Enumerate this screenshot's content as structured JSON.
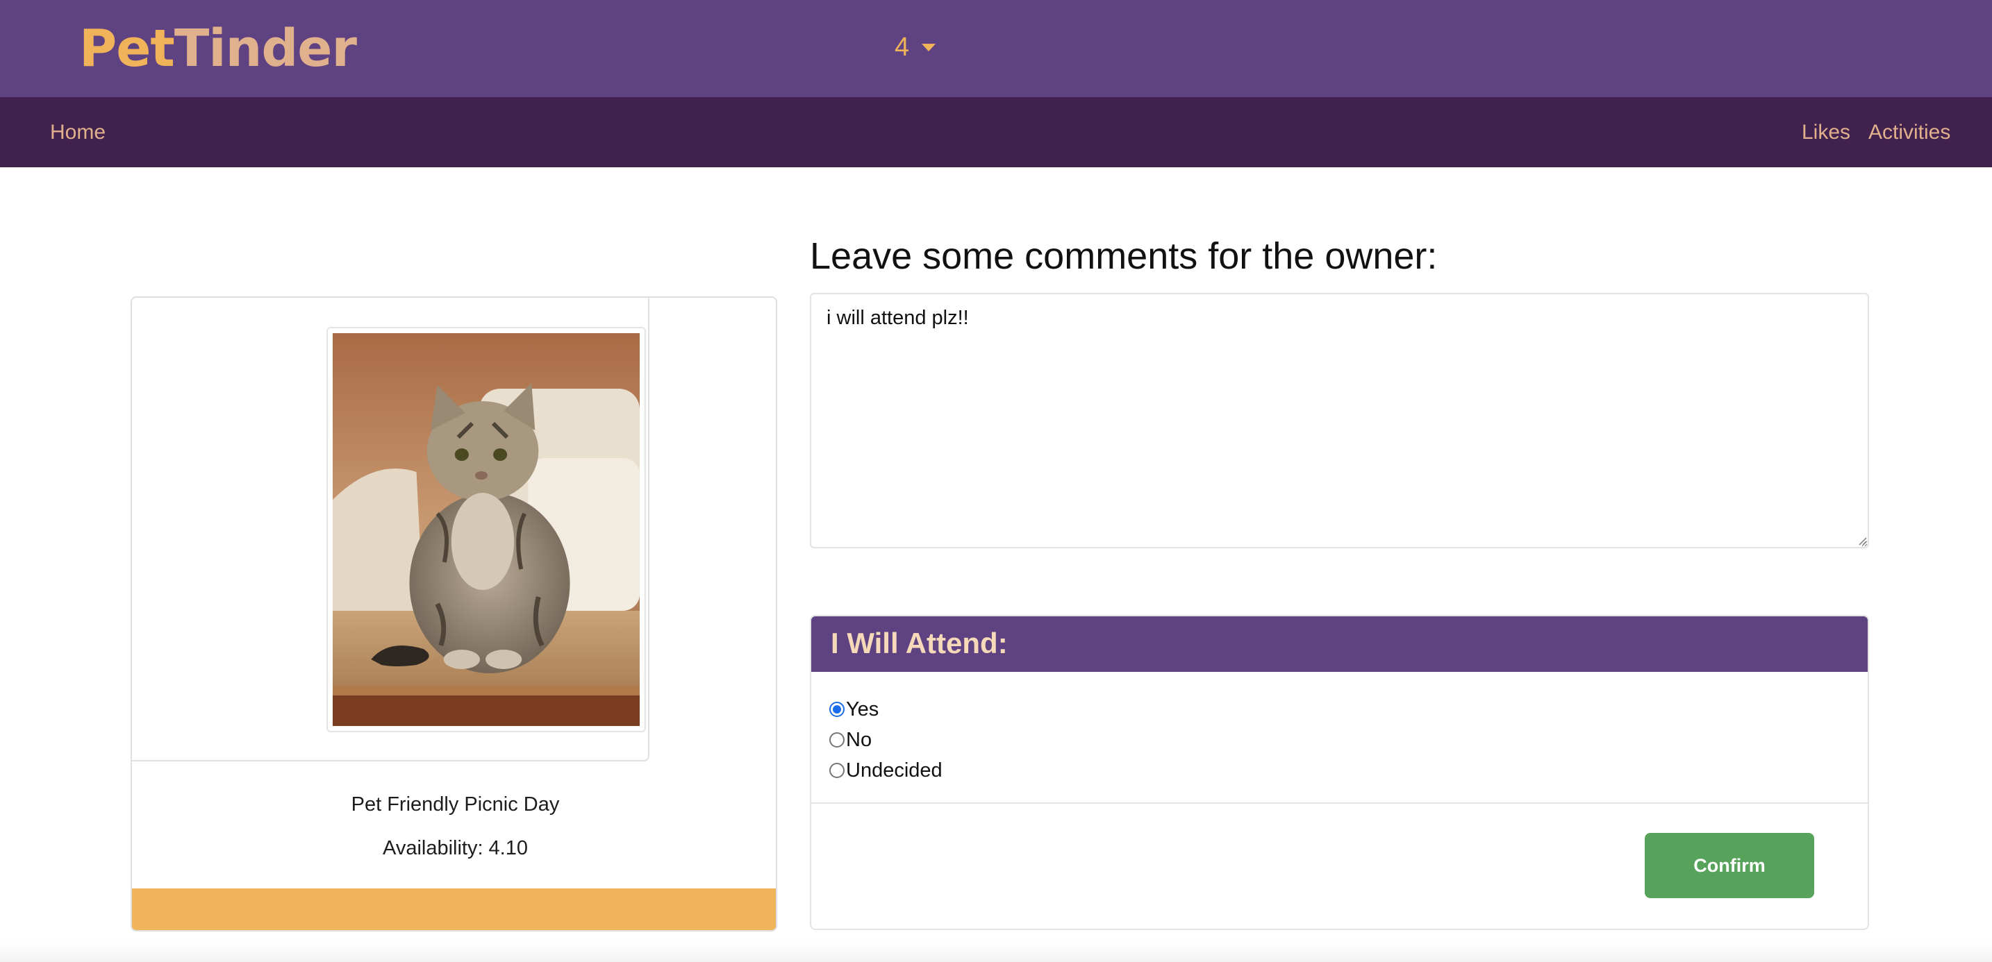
{
  "header": {
    "brand_part1": "Pet",
    "brand_part2": "Tinder",
    "dropdown_value": "4"
  },
  "nav": {
    "home": "Home",
    "likes": "Likes",
    "activities": "Activities"
  },
  "event": {
    "name": "Pet Friendly Picnic Day",
    "availability_label": "Availability:",
    "availability_value": "4.10",
    "image": "tabby-cat-photo"
  },
  "comments": {
    "heading": "Leave some comments for the owner:",
    "value": "i will attend plz!!"
  },
  "attend": {
    "title": "I Will Attend:",
    "options": [
      {
        "label": "Yes",
        "checked": true
      },
      {
        "label": "No",
        "checked": false
      },
      {
        "label": "Undecided",
        "checked": false
      }
    ],
    "confirm_label": "Confirm"
  },
  "colors": {
    "header_bg": "#5e4282",
    "nav_bg": "#41214d",
    "brand_orange": "#f0b35a",
    "link_peach": "#e1b08c",
    "card_footer": "#f0b45a",
    "confirm_green": "#57a35b",
    "radio_blue": "#1a6cea"
  }
}
